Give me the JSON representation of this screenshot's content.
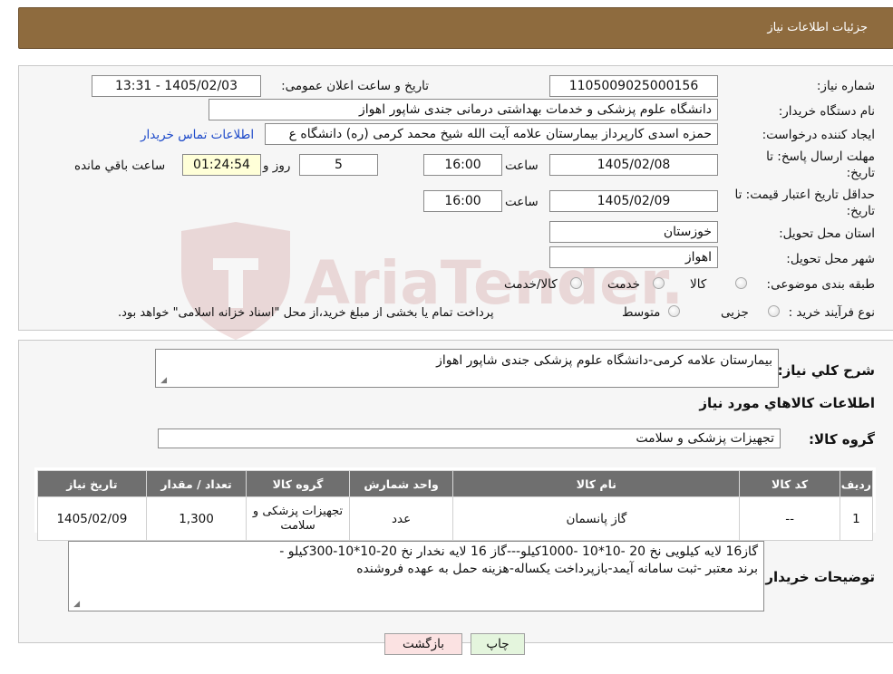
{
  "header": {
    "title": "جزئیات اطلاعات نیاز"
  },
  "watermark": {
    "text": "AriaTender.neT"
  },
  "form": {
    "need_number_label": "شماره نیاز:",
    "need_number": "1105009025000156",
    "announce_label": "تاریخ و ساعت اعلان عمومی:",
    "announce_value": "1405/02/03 - 13:31",
    "buyer_org_label": "نام دستگاه خریدار:",
    "buyer_org": "دانشگاه علوم پزشکی و خدمات بهداشتی درمانی جندی شاپور اهواز",
    "creator_label": "ایجاد کننده درخواست:",
    "creator": "حمزه اسدی کارپرداز بیمارستان علامه آیت الله شیخ محمد کرمی (ره) دانشگاه ع",
    "contact_link": "اطلاعات تماس خریدار",
    "deadline_label_1": "مهلت ارسال پاسخ: تا",
    "deadline_label_2": "تاریخ:",
    "deadline_date": "1405/02/08",
    "time_label": "ساعت",
    "deadline_time": "16:00",
    "days_value": "5",
    "days_label": "روز و",
    "remaining_time": "01:24:54",
    "remaining_label": "ساعت باقي مانده",
    "validity_label_1": "حداقل تاریخ اعتبار قیمت: تا",
    "validity_label_2": "تاریخ:",
    "validity_date": "1405/02/09",
    "validity_time_label": "ساعت",
    "validity_time": "16:00",
    "province_label": "استان محل تحویل:",
    "province": "خوزستان",
    "city_label": "شهر محل تحویل:",
    "city": "اهواز",
    "category_label": "طبقه بندی موضوعی:",
    "category_options": [
      "کالا",
      "خدمت",
      "کالا/خدمت"
    ],
    "process_label": "نوع فرآیند خرید :",
    "process_options": [
      "جزیی",
      "متوسط"
    ],
    "process_note": "پرداخت تمام یا بخشی از مبلغ خرید،از محل \"اسناد خزانه اسلامی\" خواهد بود."
  },
  "summary": {
    "desc_label": "شرح کلي نياز:",
    "desc_value": "بیمارستان علامه کرمی-دانشگاه علوم پزشکی جندی شاپور اهواز",
    "goods_info_title": "اطلاعات کالاهاي مورد نياز",
    "goods_group_label": "گروه کالا:",
    "goods_group_value": "تجهیزات پزشکی و سلامت"
  },
  "table": {
    "headers": [
      "رديف",
      "کد کالا",
      "نام کالا",
      "واحد شمارش",
      "گروه کالا",
      "تعداد / مقدار",
      "تاریخ نیاز"
    ],
    "rows": [
      [
        "1",
        "--",
        "گاز پانسمان",
        "عدد",
        "تجهیزات پزشکی و سلامت",
        "1,300",
        "1405/02/09"
      ]
    ]
  },
  "buyer_notes": {
    "label": "توضیحات خریدار:",
    "line1": "گاز16 لایه کیلویی نخ 20 -10*10 -1000کیلو---گاز 16 لایه نخدار نخ 20-10*10-300کیلو -",
    "line2": "برند معتبر -ثبت سامانه آیمد-بازپرداخت یکساله-هزینه حمل به عهده فروشنده"
  },
  "buttons": {
    "print": "چاپ",
    "back": "بازگشت"
  },
  "colors": {
    "header": "#8e6b3e",
    "table_header": "#6f6f6f",
    "print_btn": "#e4f5dd",
    "back_btn": "#fbe2e2",
    "link": "#1c49c9"
  }
}
